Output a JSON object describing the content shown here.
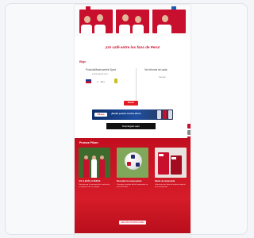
{
  "page": {
    "headline": "¡Un café entre los fans de Peru!",
    "prediction_title": "Elige",
    "home_team": {
      "name": "Polonia/Maximumble Sport",
      "sub": "Anna Heyde Linz",
      "score": "1  ·  1(1)"
    },
    "away_team": {
      "name": "Ver informe de cada",
      "sub": "Kansas"
    },
    "submit_label": "Enviar",
    "banner": {
      "logo": "Pilsen",
      "text": "¡Nadie puede contra ellos!"
    },
    "cta_bar": "Descárgalo aquí",
    "promo_section_title": "Promos Pilsen",
    "promos": [
      {
        "title": "¡YA LLEGÓ LA NUEVA",
        "body": "Participa por la camiseta de la selección y comparte con tus amigos."
      },
      {
        "title": "Descubre la nueva pelota",
        "body": "Consigue tu pelota oficial comprando un pack de Pilsen."
      },
      {
        "title": "Packs de temporada",
        "body": "Colecciona las latas de edición especial de la temporada."
      }
    ],
    "bottom_cta": "VER MÁS PROMOCIONES"
  },
  "colors": {
    "brand_red": "#c8102e",
    "banner_blue": "#1f4fa0"
  }
}
